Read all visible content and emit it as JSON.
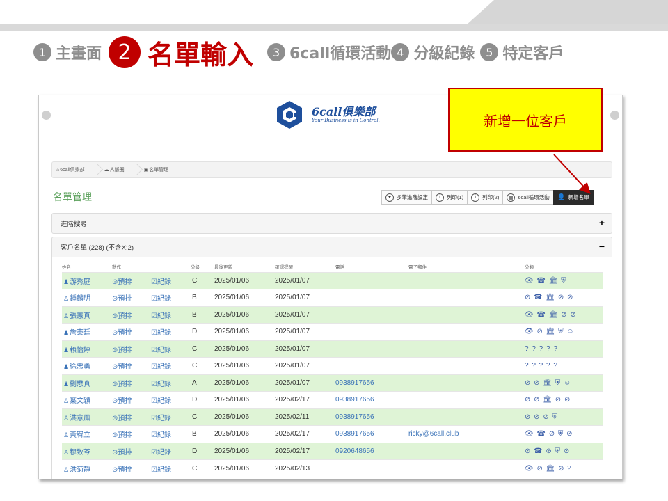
{
  "steps": [
    {
      "num": "1",
      "label": "主畫面"
    },
    {
      "num": "2",
      "label": "名單輸入"
    },
    {
      "num": "3",
      "label": "6call循環活動"
    },
    {
      "num": "4",
      "label": "分級紀錄"
    },
    {
      "num": "5",
      "label": "特定客戶"
    }
  ],
  "app": {
    "logo_name": "6call俱樂部",
    "logo_tagline": "Your Business is in Control."
  },
  "breadcrumb": [
    "6call俱樂部",
    "人脈圈",
    "名單管理"
  ],
  "page_title": "名單管理",
  "toolbar": {
    "multi_settings": "多筆進階設定",
    "print1": "列印(1)",
    "print2": "列印(2)",
    "cycle": "6call循環活動",
    "add": "新增名單"
  },
  "advanced_search": {
    "label": "進階搜尋",
    "toggle": "+"
  },
  "list_panel": {
    "label": "客戶名單 (228) (不含X:2)",
    "toggle": "−"
  },
  "columns": [
    "姓名",
    "動作",
    "",
    "分級",
    "最後更新",
    "確認提醒",
    "電話",
    "電子郵件",
    "分類"
  ],
  "rows": [
    {
      "name": "游秀庭",
      "act1": "⊙預排",
      "act2": "☑紀錄",
      "grade": "C",
      "updated": "2025/01/06",
      "reminder": "2025/01/07",
      "phone": "",
      "email": "",
      "cls": "👁 ☎ 🏛 ⛨",
      "filled": true,
      "hl": true
    },
    {
      "name": "鍾麟明",
      "act1": "⊙預排",
      "act2": "☑紀錄",
      "grade": "B",
      "updated": "2025/01/06",
      "reminder": "2025/01/07",
      "phone": "",
      "email": "",
      "cls": "⊘ ☎ 🏛 ⊘ ⊘",
      "filled": false,
      "hl": false
    },
    {
      "name": "張蕙真",
      "act1": "⊙預排",
      "act2": "☑紀錄",
      "grade": "B",
      "updated": "2025/01/06",
      "reminder": "2025/01/07",
      "phone": "",
      "email": "",
      "cls": "👁 ☎ 🏛 ⊘ ⊘",
      "filled": false,
      "hl": true
    },
    {
      "name": "詹東廷",
      "act1": "⊙預排",
      "act2": "☑紀錄",
      "grade": "D",
      "updated": "2025/01/06",
      "reminder": "2025/01/07",
      "phone": "",
      "email": "",
      "cls": "👁 ⊘ 🏛 ⛨ ☺",
      "filled": true,
      "hl": false
    },
    {
      "name": "賴怡婷",
      "act1": "⊙預排",
      "act2": "☑紀錄",
      "grade": "C",
      "updated": "2025/01/06",
      "reminder": "2025/01/07",
      "phone": "",
      "email": "",
      "cls": "? ? ? ? ?",
      "filled": true,
      "hl": true
    },
    {
      "name": "徐忠勇",
      "act1": "⊙預排",
      "act2": "☑紀錄",
      "grade": "C",
      "updated": "2025/01/06",
      "reminder": "2025/01/07",
      "phone": "",
      "email": "",
      "cls": "? ? ? ? ?",
      "filled": true,
      "hl": false
    },
    {
      "name": "劉懋真",
      "act1": "⊙預排",
      "act2": "☑紀錄",
      "grade": "A",
      "updated": "2025/01/06",
      "reminder": "2025/01/07",
      "phone": "0938917656",
      "email": "",
      "cls": "⊘ ⊘ 🏛 ⛨ ☺",
      "filled": true,
      "hl": true
    },
    {
      "name": "葉文穎",
      "act1": "⊙預排",
      "act2": "☑紀錄",
      "grade": "D",
      "updated": "2025/01/06",
      "reminder": "2025/02/17",
      "phone": "0938917656",
      "email": "",
      "cls": "⊘ ⊘ 🏛 ⊘ ⊘",
      "filled": false,
      "hl": false
    },
    {
      "name": "洪意鳳",
      "act1": "⊙預排",
      "act2": "☑紀錄",
      "grade": "C",
      "updated": "2025/01/06",
      "reminder": "2025/02/11",
      "phone": "0938917656",
      "email": "",
      "cls": "⊘ ⊘ ⊘ ⛨",
      "filled": false,
      "hl": true
    },
    {
      "name": "黃宥立",
      "act1": "⊙預排",
      "act2": "☑紀錄",
      "grade": "B",
      "updated": "2025/01/06",
      "reminder": "2025/02/17",
      "phone": "0938917656",
      "email": "ricky@6call.club",
      "cls": "👁 ☎ ⊘ ⛨ ⊘",
      "filled": false,
      "hl": false
    },
    {
      "name": "穆致苓",
      "act1": "⊙預排",
      "act2": "☑紀錄",
      "grade": "D",
      "updated": "2025/01/06",
      "reminder": "2025/02/17",
      "phone": "0920648656",
      "email": "",
      "cls": "⊘ ☎ ⊘ ⛨ ⊘",
      "filled": false,
      "hl": true
    },
    {
      "name": "洪菊靜",
      "act1": "⊙預排",
      "act2": "☑紀錄",
      "grade": "C",
      "updated": "2025/01/06",
      "reminder": "2025/02/13",
      "phone": "",
      "email": "",
      "cls": "👁 ⊘ 🏛 ⊘ ?",
      "filled": false,
      "hl": false
    }
  ],
  "callout": "新增一位客戶",
  "colors": {
    "accent_red": "#c00000",
    "callout_yellow": "#ffff00",
    "row_green": "#dff4d6",
    "link_blue": "#3b73b8",
    "title_green": "#5aa05a"
  }
}
